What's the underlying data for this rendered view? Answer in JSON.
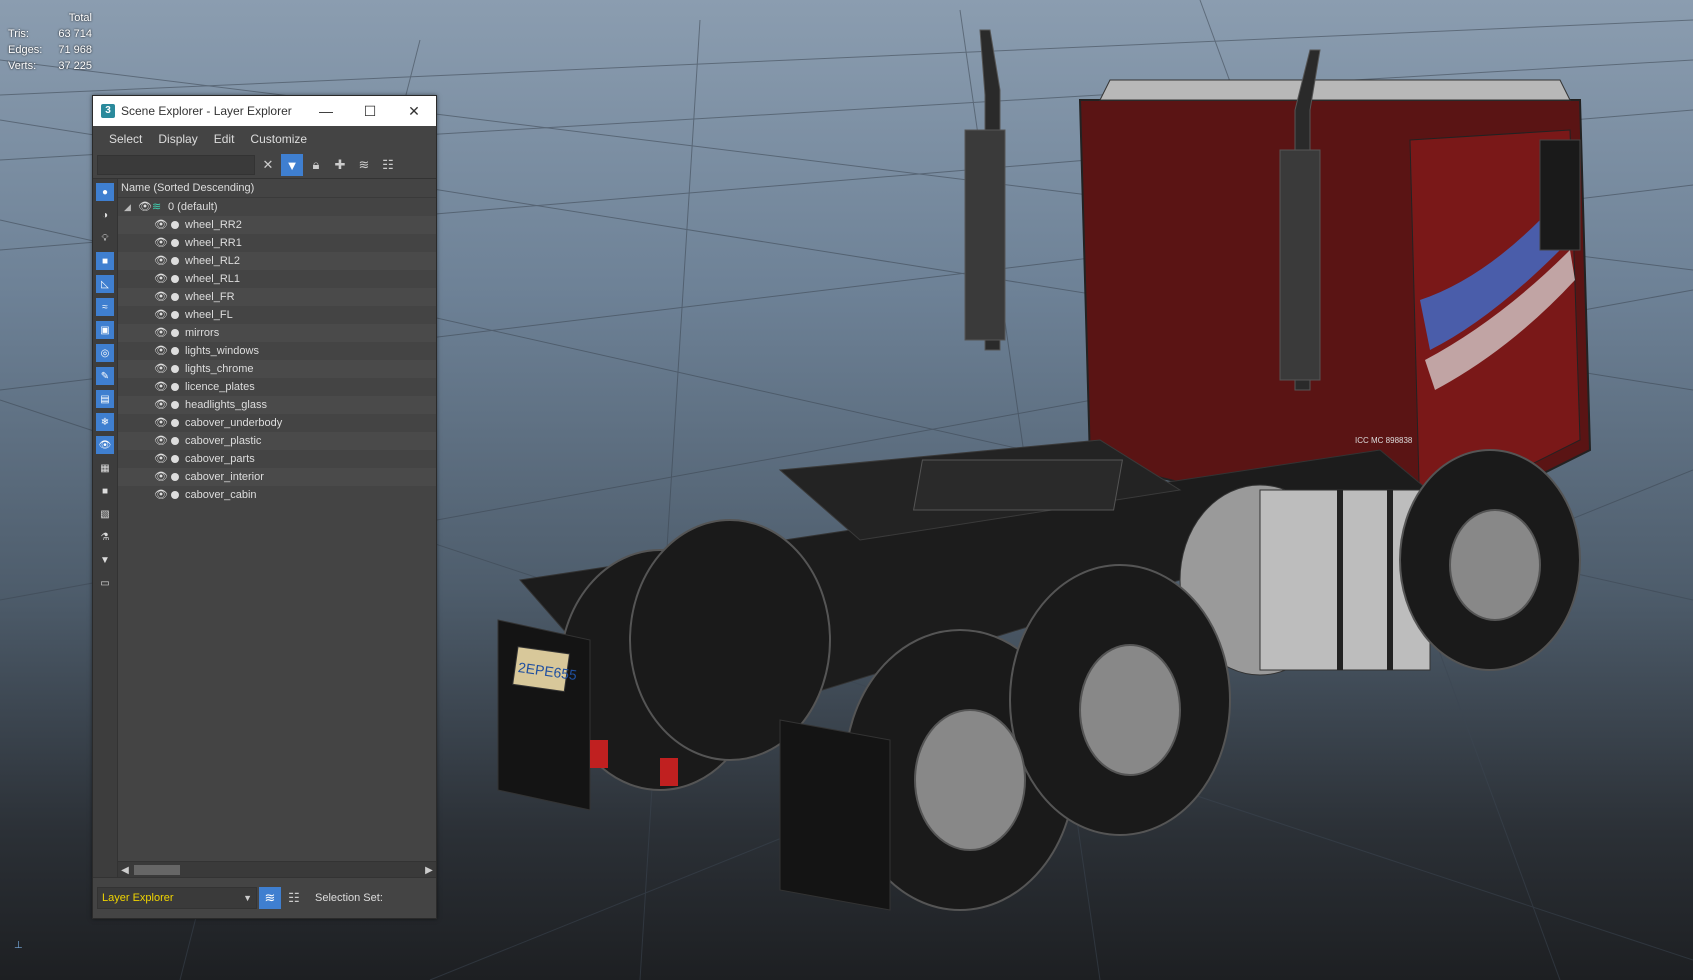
{
  "viewport": {
    "stats": {
      "header": "Total",
      "rows": [
        {
          "label": "Tris:",
          "value": "63 714"
        },
        {
          "label": "Edges:",
          "value": "71 968"
        },
        {
          "label": "Verts:",
          "value": "37 225"
        }
      ]
    },
    "license_plate": "2EPE655",
    "truck_text": "ICC MC 898838"
  },
  "explorer": {
    "title": "Scene Explorer - Layer Explorer",
    "app_icon": "3",
    "menu": [
      "Select",
      "Display",
      "Edit",
      "Customize"
    ],
    "search": {
      "value": "",
      "placeholder": ""
    },
    "column_header": "Name (Sorted Descending)",
    "root_layer": "0 (default)",
    "objects": [
      "wheel_RR2",
      "wheel_RR1",
      "wheel_RL2",
      "wheel_RL1",
      "wheel_FR",
      "wheel_FL",
      "mirrors",
      "lights_windows",
      "lights_chrome",
      "licence_plates",
      "headlights_glass",
      "cabover_underbody",
      "cabover_plastic",
      "cabover_parts",
      "cabover_interior",
      "cabover_cabin"
    ],
    "mode_select": "Layer Explorer",
    "selection_set_label": "Selection Set:"
  }
}
